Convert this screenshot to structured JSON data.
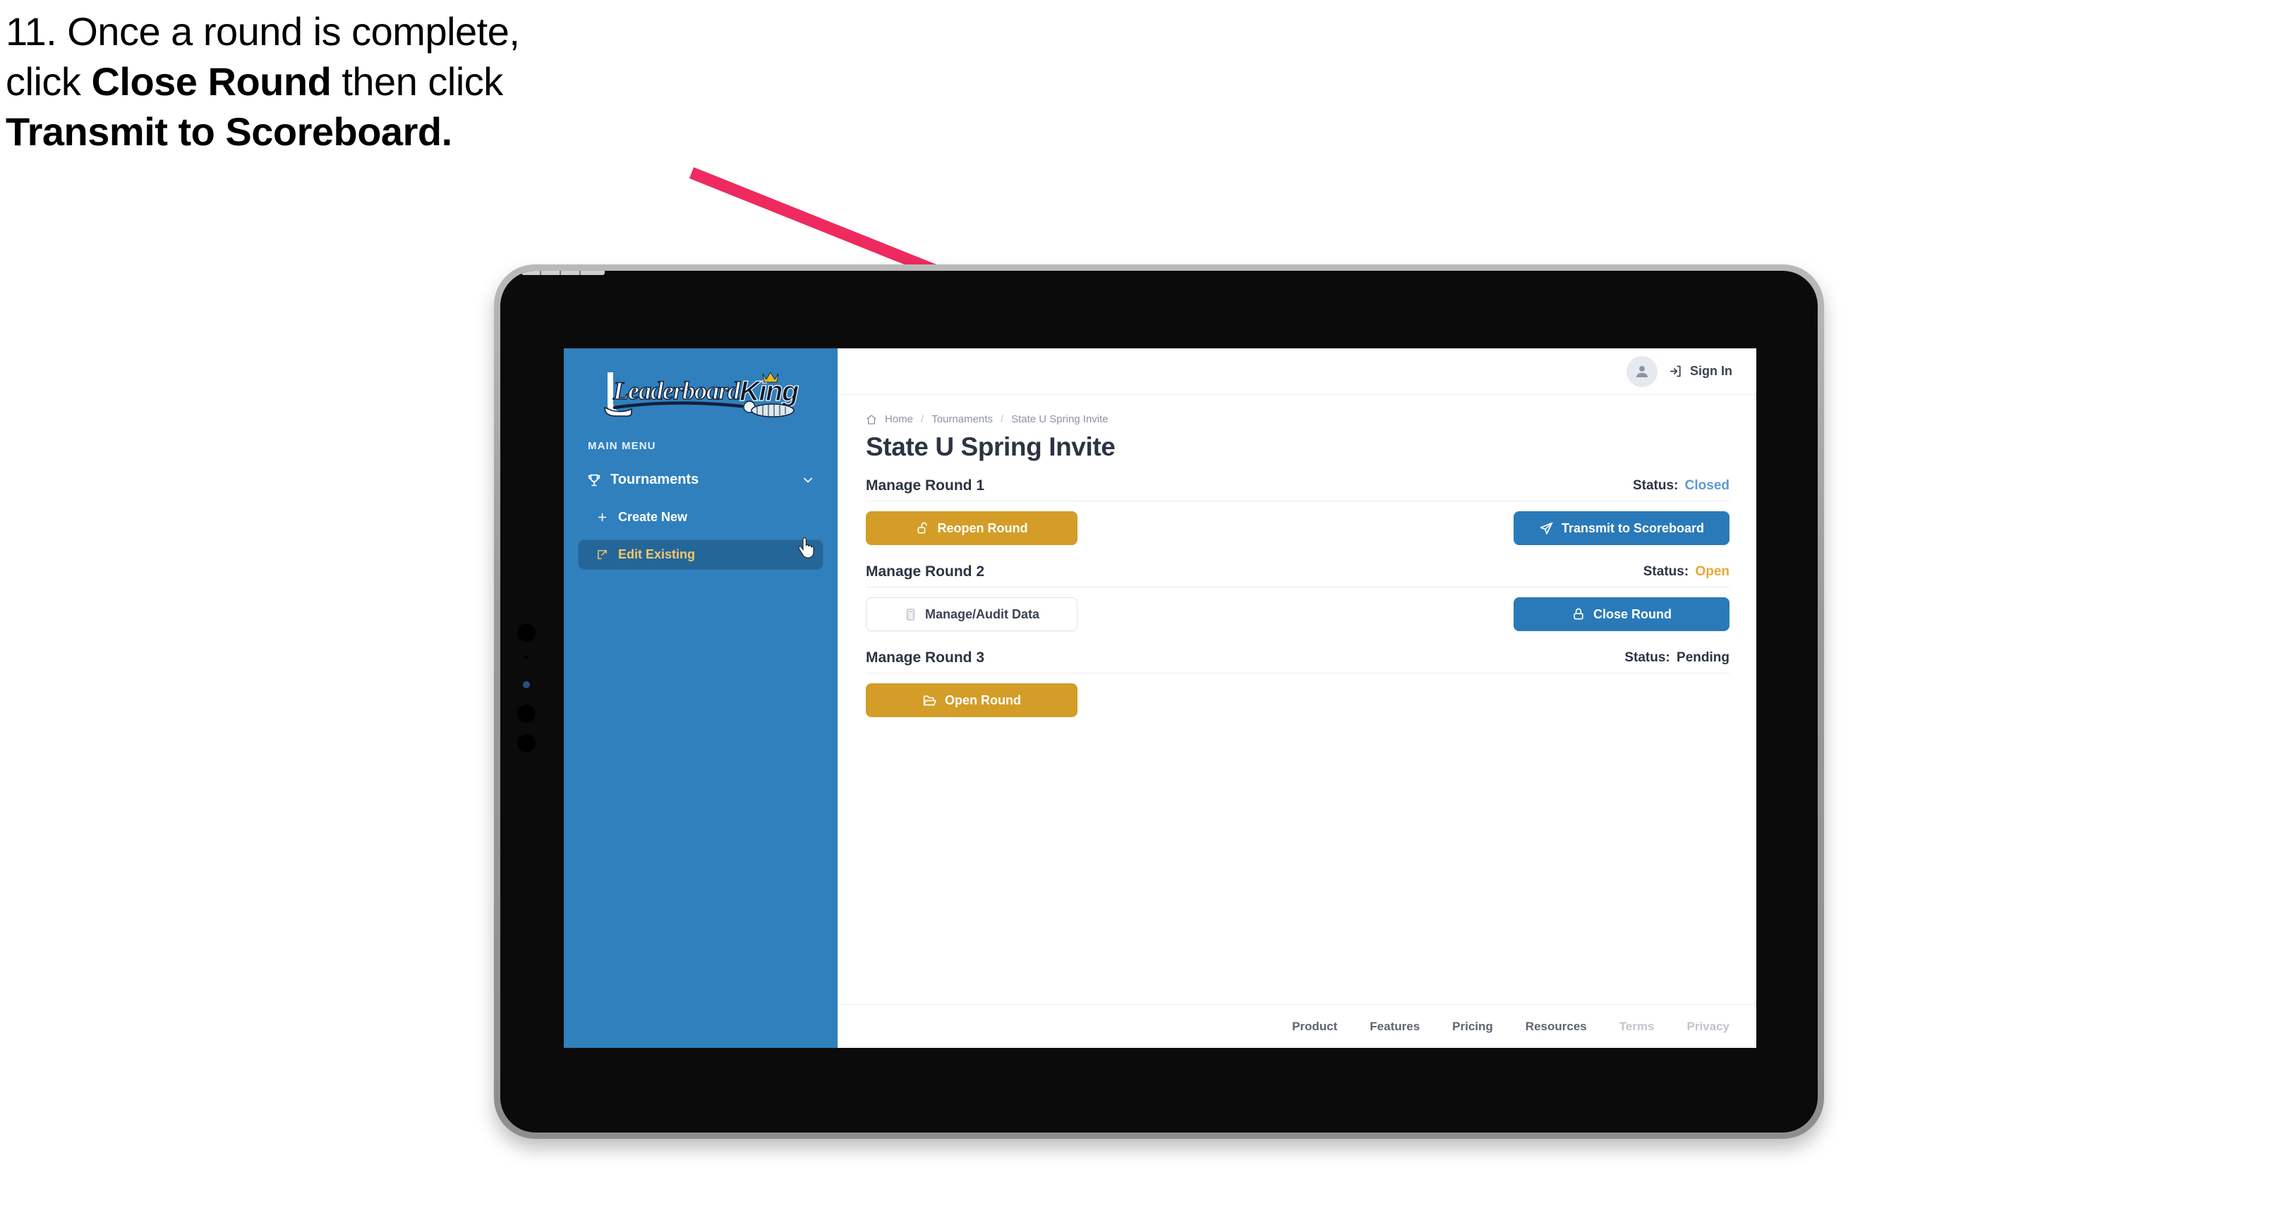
{
  "caption": {
    "line1_plain": "11. Once a round is complete,",
    "line2_pre": "click ",
    "line2_bold": "Close Round",
    "line2_post": " then click",
    "line3_bold": "Transmit to Scoreboard."
  },
  "annotation": {
    "arrow_color": "#ef2a5e",
    "arrow_from": "980,245",
    "arrow_to": "2110,700"
  },
  "device": {
    "frame_color": "#9a9a9a",
    "bezel_color": "#0b0b0b"
  },
  "sidebar": {
    "brand": {
      "word_one": "Leaderboard",
      "word_two": "King",
      "color_primary": "#ffffff",
      "color_secondary": "#111a2b",
      "crown_color": "#e8b726"
    },
    "background": "#2f80bd",
    "section_label": "MAIN MENU",
    "nav": [
      {
        "label": "Tournaments",
        "icon": "trophy-icon",
        "chevron": "chevron-down-icon",
        "active": false
      },
      {
        "label": "Create New",
        "icon": "plus-icon",
        "active": false
      },
      {
        "label": "Edit Existing",
        "icon": "edit-square-icon",
        "active": true
      }
    ]
  },
  "topbar": {
    "avatar_icon": "user-avatar-icon",
    "signin_icon": "sign-in-arrow-icon",
    "signin_label": "Sign In"
  },
  "breadcrumb": {
    "home_icon": "home-icon",
    "items": [
      "Home",
      "Tournaments",
      "State U Spring Invite"
    ],
    "separator": "/"
  },
  "page": {
    "title": "State U Spring Invite"
  },
  "rounds": [
    {
      "title": "Manage Round 1",
      "status_label": "Status:",
      "status_value": "Closed",
      "status_class": "closed",
      "left_button": {
        "label": "Reopen Round",
        "icon": "unlock-icon",
        "style": "gold"
      },
      "right_button": {
        "label": "Transmit to Scoreboard",
        "icon": "paper-plane-icon",
        "style": "blue"
      }
    },
    {
      "title": "Manage Round 2",
      "status_label": "Status:",
      "status_value": "Open",
      "status_class": "open",
      "left_button": {
        "label": "Manage/Audit Data",
        "icon": "calculator-icon",
        "style": "ghost"
      },
      "right_button": {
        "label": "Close Round",
        "icon": "lock-icon",
        "style": "blue"
      }
    },
    {
      "title": "Manage Round 3",
      "status_label": "Status:",
      "status_value": "Pending",
      "status_class": "pending",
      "left_button": {
        "label": "Open Round",
        "icon": "folder-open-icon",
        "style": "gold"
      },
      "right_button": null
    }
  ],
  "footer": {
    "links": [
      {
        "label": "Product",
        "muted": false
      },
      {
        "label": "Features",
        "muted": false
      },
      {
        "label": "Pricing",
        "muted": false
      },
      {
        "label": "Resources",
        "muted": false
      },
      {
        "label": "Terms",
        "muted": true
      },
      {
        "label": "Privacy",
        "muted": true
      }
    ]
  },
  "colors": {
    "accent_blue": "#2a7ab9",
    "accent_gold": "#d39d28",
    "sidebar_blue": "#2f80bd",
    "status_closed": "#5b9bd5",
    "status_open": "#e5a83a",
    "arrow_pink": "#ef2a5e"
  }
}
